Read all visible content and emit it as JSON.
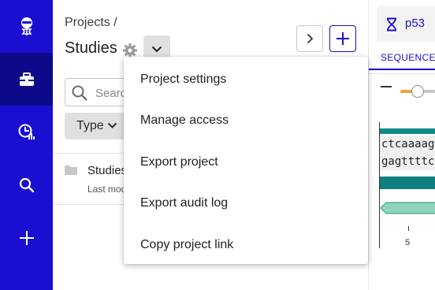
{
  "nav": {
    "items": [
      {
        "icon": "user-avatar-icon",
        "active": false
      },
      {
        "icon": "briefcase-icon",
        "active": true
      },
      {
        "icon": "analytics-icon",
        "active": false
      },
      {
        "icon": "search-icon",
        "active": false
      },
      {
        "icon": "plus-icon",
        "active": false
      }
    ]
  },
  "header": {
    "breadcrumb": "Projects /",
    "title": "Studies"
  },
  "search": {
    "placeholder": "Search"
  },
  "filters": {
    "type_label": "Type"
  },
  "list": {
    "rows": [
      {
        "name": "Studies",
        "meta": "Last modified"
      }
    ]
  },
  "menu": {
    "items": [
      {
        "label": "Project settings"
      },
      {
        "label": "Manage access"
      },
      {
        "label": "Export project"
      },
      {
        "label": "Export audit log"
      },
      {
        "label": "Copy project link"
      }
    ]
  },
  "sequence": {
    "tab_label": "p53",
    "subtab_label": "SEQUENCE",
    "zoom_level": 0.25,
    "top_strand": "ctcaaaagt",
    "bottom_strand": "gagttttca",
    "tick_label": "5"
  },
  "colors": {
    "brand": "#1a0fd0",
    "nav_active": "#0d0a8a",
    "feature_teal": "#0e7f7f",
    "feature_mint": "#8fd5be",
    "zoom_accent": "#f0a33c"
  }
}
